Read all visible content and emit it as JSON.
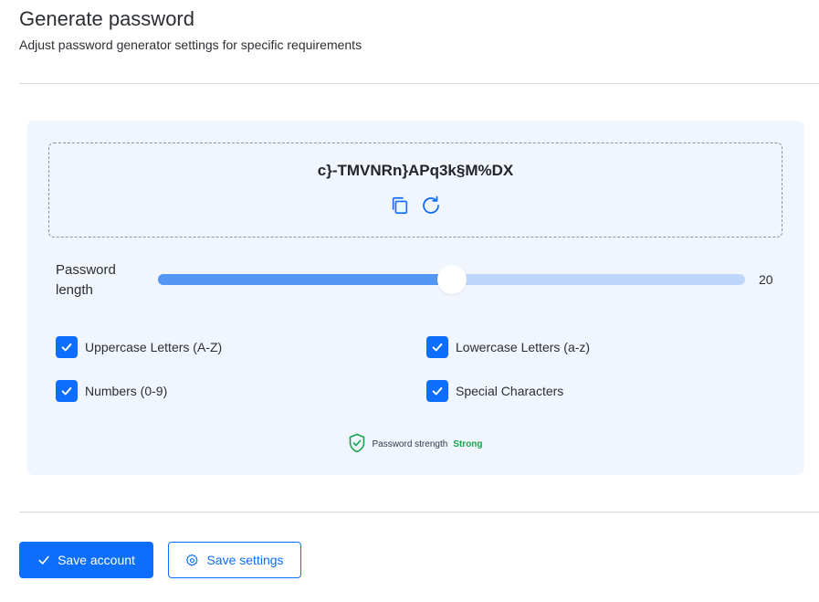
{
  "header": {
    "title": "Generate password",
    "subtitle": "Adjust password generator settings for specific requirements"
  },
  "generator": {
    "password": "c}-TMVNRn}APq3k§M%DX",
    "actions": [
      {
        "name": "copy-icon"
      },
      {
        "name": "refresh-icon"
      }
    ],
    "length": {
      "label": "Password length",
      "value": "20",
      "min": 0,
      "max": 40,
      "current": 20
    },
    "options": [
      {
        "label": "Uppercase Letters (A-Z)",
        "checked": true
      },
      {
        "label": "Lowercase Letters (a-z)",
        "checked": true
      },
      {
        "label": "Numbers (0-9)",
        "checked": true
      },
      {
        "label": "Special Characters",
        "checked": true
      }
    ],
    "strength": {
      "label": "Password strength",
      "value": "Strong",
      "color": "#16a34a"
    }
  },
  "footer": {
    "save_account_label": "Save account",
    "save_settings_label": "Save settings"
  },
  "colors": {
    "primary": "#0d6efd",
    "panel_bg": "#f1f5fd",
    "slider_fill": "#5297f3",
    "slider_track": "#bdd6fa",
    "success": "#16a34a"
  }
}
